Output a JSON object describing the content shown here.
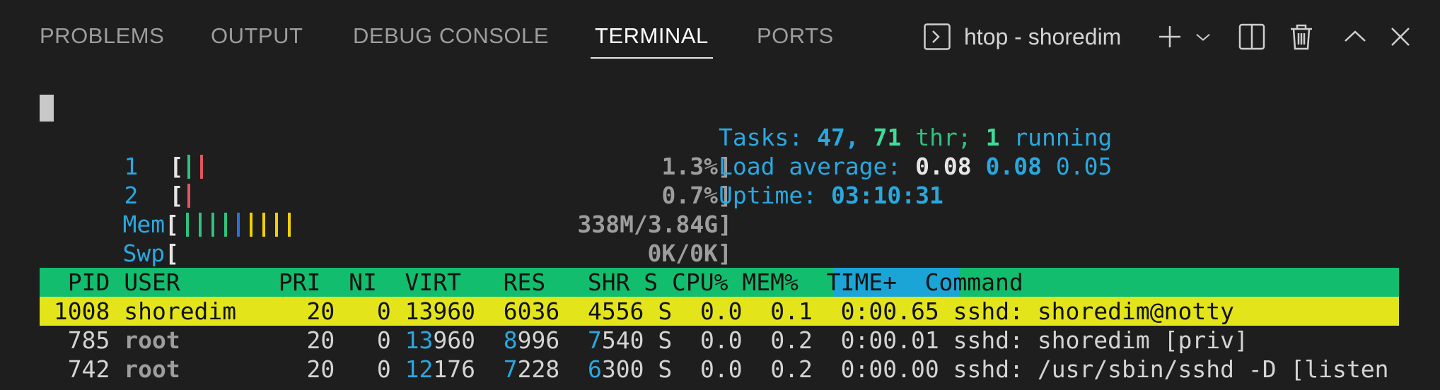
{
  "panel": {
    "tabs": [
      {
        "label": "PROBLEMS"
      },
      {
        "label": "OUTPUT"
      },
      {
        "label": "DEBUG CONSOLE"
      },
      {
        "label": "TERMINAL",
        "active": true
      },
      {
        "label": "PORTS"
      }
    ],
    "terminal_name": "htop - shoredim",
    "icons": [
      "terminal-icon",
      "add-icon",
      "chevron-down-icon",
      "split-icon",
      "trash-icon",
      "chevron-up-icon",
      "close-icon"
    ]
  },
  "htop": {
    "meters": {
      "cpu1": {
        "label": "1",
        "value": "1.3%]"
      },
      "cpu2": {
        "label": "2",
        "value": "0.7%]"
      },
      "mem": {
        "label": "Mem",
        "value": "338M/3.84G]"
      },
      "swp": {
        "label": "Swp",
        "value": "0K/0K]"
      }
    },
    "stats": {
      "tasks_label": "Tasks:",
      "tasks": "47,",
      "threads": "71",
      "thr_label": "thr;",
      "running": "1",
      "running_label": "running",
      "load_label": "Load average:",
      "load1": "0.08",
      "load5": "0.08",
      "load15": "0.05",
      "uptime_label": "Uptime:",
      "uptime": "03:10:31"
    },
    "columns_pre": "  PID USER       PRI  NI  VIRT   RES   SHR S CPU% MEM%",
    "columns_time": "  TIME+  ",
    "columns_cmd": "Command",
    "rows": [
      {
        "pid": " 1008",
        "user": "shoredim",
        "pri": "20",
        "ni": "0",
        "virt": "13960",
        "res": "6036",
        "shr": "4556",
        "s": "S",
        "cpu": "0.0",
        "mem": "0.1",
        "time": "0:00.65",
        "cmd": "sshd: shoredim@notty"
      },
      {
        "pid": "  785",
        "user": "root",
        "pri": "20",
        "ni": "0",
        "virt_hi": "13",
        "virt_lo": "960",
        "res_hi": "8",
        "res_lo": "996",
        "shr_hi": "7",
        "shr_lo": "540",
        "s": "S",
        "cpu": "0.0",
        "mem": "0.2",
        "time": "0:00.01",
        "cmd": "sshd: shoredim [priv]"
      },
      {
        "pid": "  742",
        "user": "root",
        "pri": "20",
        "ni": "0",
        "virt_hi": "12",
        "virt_lo": "176",
        "res_hi": "7",
        "res_lo": "228",
        "shr_hi": "6",
        "shr_lo": "300",
        "s": "S",
        "cpu": "0.0",
        "mem": "0.2",
        "time": "0:00.00",
        "cmd": "sshd: /usr/sbin/sshd -D [listen"
      }
    ]
  },
  "colors": {
    "background": "#1e1e1e",
    "header_green": "#13bd6e",
    "header_time_blue": "#1aa5d6",
    "selected_row_yellow": "#e3e51a",
    "cyan": "#29a8e0"
  }
}
